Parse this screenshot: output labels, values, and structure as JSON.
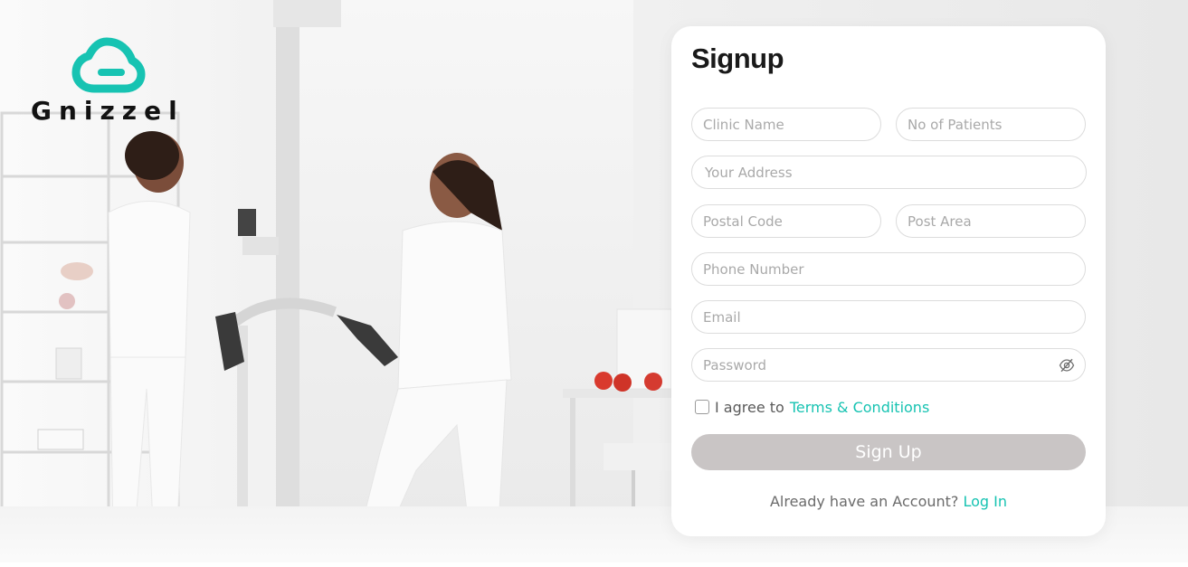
{
  "brand": {
    "name": "Gnizzel",
    "accent_color": "#17c3b2"
  },
  "background": {
    "description_icon": "clinic-photo"
  },
  "signup": {
    "title": "Signup",
    "fields": {
      "clinic_name": {
        "placeholder": "Clinic Name",
        "value": ""
      },
      "patients": {
        "placeholder": "No of Patients",
        "value": ""
      },
      "address": {
        "placeholder": "Your Address",
        "value": ""
      },
      "postal_code": {
        "placeholder": "Postal Code",
        "value": ""
      },
      "post_area": {
        "placeholder": "Post Area",
        "value": ""
      },
      "phone": {
        "placeholder": "Phone Number",
        "value": ""
      },
      "email": {
        "placeholder": "Email",
        "value": ""
      },
      "password": {
        "placeholder": "Password",
        "value": "",
        "icon": "eye-off-icon"
      }
    },
    "agree": {
      "text": "I agree to",
      "link": "Terms & Conditions",
      "checked": false
    },
    "submit_label": "Sign Up",
    "submit_color": "#c9c5c5",
    "login_prompt": "Already have an Account?",
    "login_link": "Log In"
  }
}
